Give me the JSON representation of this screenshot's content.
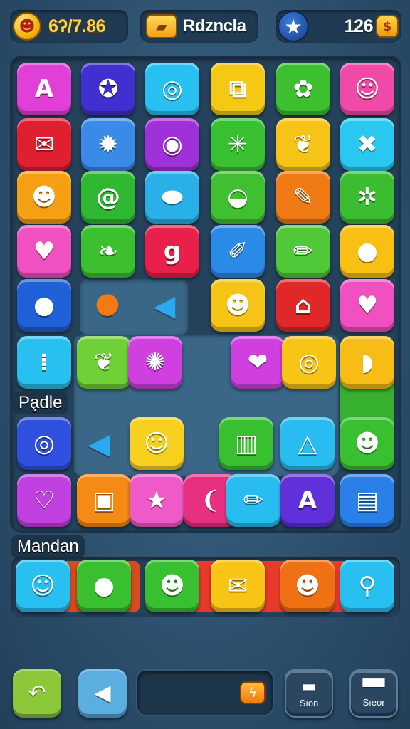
{
  "topbar": {
    "coins_value": "6ʔ/7.86",
    "title": "Rdzncla",
    "stars_value": "126",
    "coin_icon": "coin-face-icon",
    "title_icon": "gold-bar-icon",
    "star_icon": "star-icon",
    "small_coin_icon": "gold-coin-icon"
  },
  "labels": {
    "section_one": "Pa̧dle",
    "section_two": "Mandan"
  },
  "board": {
    "tiles": [
      {
        "name": "tile-letter-a-pink",
        "glyph": "A",
        "color": "#e040d8"
      },
      {
        "name": "tile-star-shield",
        "glyph": "✪",
        "color": "#4030d0"
      },
      {
        "name": "tile-swirl-cyan",
        "glyph": "◎",
        "color": "#28c0f0"
      },
      {
        "name": "tile-blocks-yellow",
        "glyph": "⧉",
        "color": "#f5c816"
      },
      {
        "name": "tile-turtle-green",
        "glyph": "✿",
        "color": "#3cc030"
      },
      {
        "name": "tile-smiley-pink",
        "glyph": "☺",
        "color": "#f04aa8"
      },
      {
        "name": "tile-chat-red",
        "glyph": "✉",
        "color": "#e02030"
      },
      {
        "name": "tile-fox-blue",
        "glyph": "✹",
        "color": "#3a8ae8"
      },
      {
        "name": "tile-ring-purple",
        "glyph": "◉",
        "color": "#a030d8"
      },
      {
        "name": "tile-sun-green",
        "glyph": "✳",
        "color": "#38c030"
      },
      {
        "name": "tile-leaf-yellow",
        "glyph": "❦",
        "color": "#f5c416"
      },
      {
        "name": "tile-cross-cyan",
        "glyph": "✖",
        "color": "#28c8f0"
      },
      {
        "name": "tile-cat-orange",
        "glyph": "☻",
        "color": "#f5a012"
      },
      {
        "name": "tile-spiral-green",
        "glyph": "@",
        "color": "#30b830"
      },
      {
        "name": "tile-oval-cyan",
        "glyph": "⬬",
        "color": "#2ab0e8"
      },
      {
        "name": "tile-bowl-green",
        "glyph": "◒",
        "color": "#40c030"
      },
      {
        "name": "tile-scroll-orange",
        "glyph": "✎",
        "color": "#f07a14"
      },
      {
        "name": "tile-gear-green",
        "glyph": "✲",
        "color": "#3cbc30"
      },
      {
        "name": "tile-heart-pink",
        "glyph": "♥",
        "color": "#f050c0"
      },
      {
        "name": "tile-leaf-green",
        "glyph": "❧",
        "color": "#3cc030"
      },
      {
        "name": "tile-g-red",
        "glyph": "g",
        "color": "#e8204a"
      },
      {
        "name": "tile-pencil-blue",
        "glyph": "✐",
        "color": "#2a8ae8"
      },
      {
        "name": "tile-marker-green",
        "glyph": "✏",
        "color": "#50c838"
      },
      {
        "name": "tile-pear-yellow",
        "glyph": "●",
        "color": "#f8c012"
      },
      {
        "name": "tile-apple-blue",
        "glyph": "●",
        "color": "#2060d8"
      },
      {
        "name": "tile-devil-yellow",
        "glyph": "☻",
        "color": "#f5c416"
      },
      {
        "name": "tile-house-red",
        "glyph": "⌂",
        "color": "#e02828"
      },
      {
        "name": "tile-cloud-pink",
        "glyph": "♥",
        "color": "#f050c0"
      },
      {
        "name": "tile-domino-cyan",
        "glyph": "⁞",
        "color": "#28c0f0"
      },
      {
        "name": "tile-leaf-lime",
        "glyph": "❦",
        "color": "#70d038"
      },
      {
        "name": "tile-flower-magenta",
        "glyph": "✺",
        "color": "#d040e0"
      },
      {
        "name": "tile-ribbon-magenta",
        "glyph": "❤",
        "color": "#d040e0"
      },
      {
        "name": "tile-target-yellow",
        "glyph": "◎",
        "color": "#f8c416"
      },
      {
        "name": "tile-shell-yellow",
        "glyph": "◗",
        "color": "#f8bc16"
      },
      {
        "name": "tile-ring-blue",
        "glyph": "◎",
        "color": "#3050e0"
      },
      {
        "name": "tile-bear-yellow",
        "glyph": "☺",
        "color": "#f8d020"
      },
      {
        "name": "tile-bars-green",
        "glyph": "▥",
        "color": "#38c030"
      },
      {
        "name": "tile-triangle-cyan",
        "glyph": "△",
        "color": "#28bcf0"
      },
      {
        "name": "tile-bear-green",
        "glyph": "☻",
        "color": "#38c030"
      },
      {
        "name": "tile-heart-magenta",
        "glyph": "♡",
        "color": "#c040e0"
      },
      {
        "name": "tile-jar-orange",
        "glyph": "▣",
        "color": "#f58a14"
      },
      {
        "name": "tile-star-pink",
        "glyph": "★",
        "color": "#f05ac8"
      },
      {
        "name": "tile-chili-pink",
        "glyph": "❨",
        "color": "#e83080"
      },
      {
        "name": "tile-pencil-cyan",
        "glyph": "✏",
        "color": "#28bcf0"
      },
      {
        "name": "tile-a-purple",
        "glyph": "A",
        "color": "#6030d8"
      },
      {
        "name": "tile-book-blue",
        "glyph": "▤",
        "color": "#2a80e8"
      }
    ],
    "loose_pieces": [
      {
        "name": "drop-piece",
        "glyph": "●",
        "color": "#f57a14"
      },
      {
        "name": "bird-piece-one",
        "glyph": "◀",
        "color": "#2aa8f0"
      },
      {
        "name": "bird-piece-two",
        "glyph": "◀",
        "color": "#2aa8f0"
      }
    ]
  },
  "strip": {
    "tiles": [
      {
        "name": "strip-smiley-cyan",
        "glyph": "☺",
        "color": "#28c0f0"
      },
      {
        "name": "strip-apple-green",
        "glyph": "●",
        "color": "#38c030"
      },
      {
        "name": "strip-cat-green",
        "glyph": "☻",
        "color": "#38c030"
      },
      {
        "name": "strip-envelope-yellow",
        "glyph": "✉",
        "color": "#f8c416"
      },
      {
        "name": "strip-devil-orange",
        "glyph": "☻",
        "color": "#f07014"
      },
      {
        "name": "strip-magnifier-cyan",
        "glyph": "⚲",
        "color": "#28c0f0"
      }
    ]
  },
  "controls": {
    "undo_glyph": "↶",
    "sound_glyph": "◀",
    "shop_label": "Sıon",
    "shop_glyph": "▬",
    "stats_label": "Sıeor",
    "stats_glyph": "▀▀",
    "progress_icon_glyph": "ϟ",
    "progress_fill": 0.0,
    "colors": {
      "undo": "#8cc83a",
      "sound": "#5aaee0",
      "shop": "#2a4660",
      "stats": "#2a4660"
    }
  }
}
